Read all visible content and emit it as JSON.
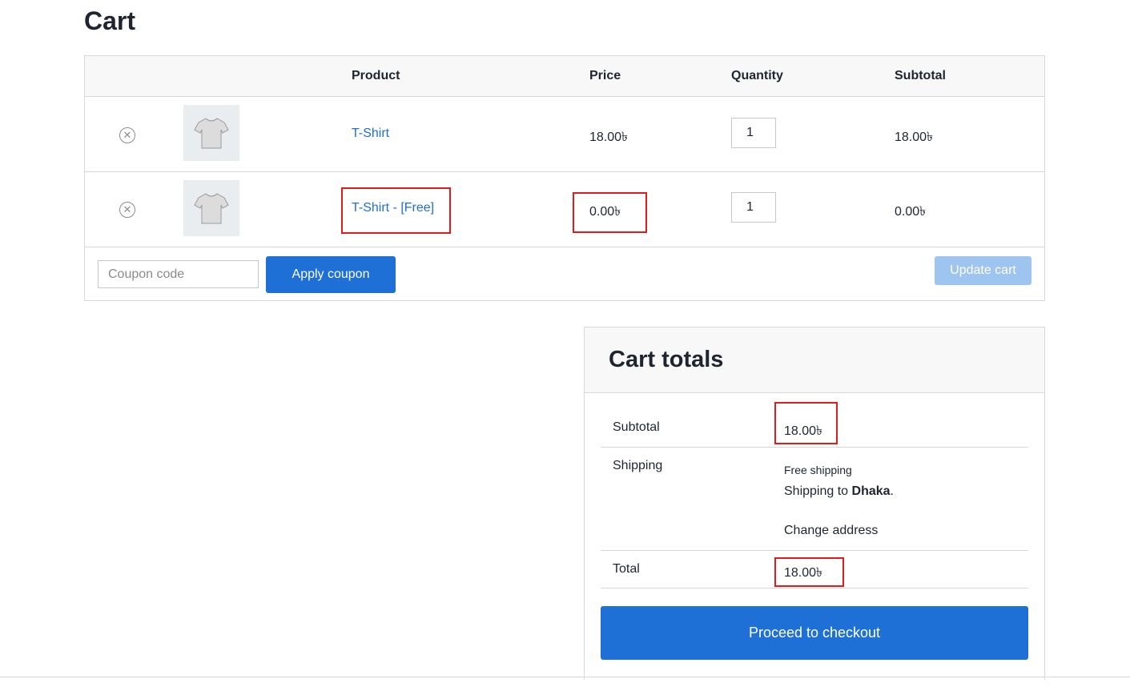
{
  "page": {
    "title": "Cart"
  },
  "cart_table": {
    "headers": {
      "product": "Product",
      "price": "Price",
      "quantity": "Quantity",
      "subtotal": "Subtotal"
    },
    "rows": [
      {
        "product_name": "T-Shirt",
        "price": "18.00৳",
        "quantity": "1",
        "subtotal": "18.00৳",
        "remove_icon": "remove-circle-icon",
        "thumbnail": "tshirt-thumbnail"
      },
      {
        "product_name": "T-Shirt - [Free]",
        "price": "0.00৳",
        "quantity": "1",
        "subtotal": "0.00৳",
        "remove_icon": "remove-circle-icon",
        "thumbnail": "tshirt-thumbnail"
      }
    ]
  },
  "actions": {
    "coupon_placeholder": "Coupon code",
    "apply_coupon_label": "Apply coupon",
    "update_cart_label": "Update cart"
  },
  "cart_totals": {
    "title": "Cart totals",
    "subtotal_label": "Subtotal",
    "subtotal_value": "18.00৳",
    "shipping_label": "Shipping",
    "shipping_method": "Free shipping",
    "shipping_to_prefix": "Shipping to ",
    "shipping_city": "Dhaka",
    "shipping_to_suffix": ".",
    "change_address_label": "Change address",
    "total_label": "Total",
    "total_value": "18.00৳",
    "checkout_label": "Proceed to checkout"
  },
  "colors": {
    "accent": "#1e6fd6",
    "accent_disabled": "#9ec4f0",
    "highlight": "#e31b1b",
    "text": "#1e2530",
    "border": "#d8d8d8"
  }
}
